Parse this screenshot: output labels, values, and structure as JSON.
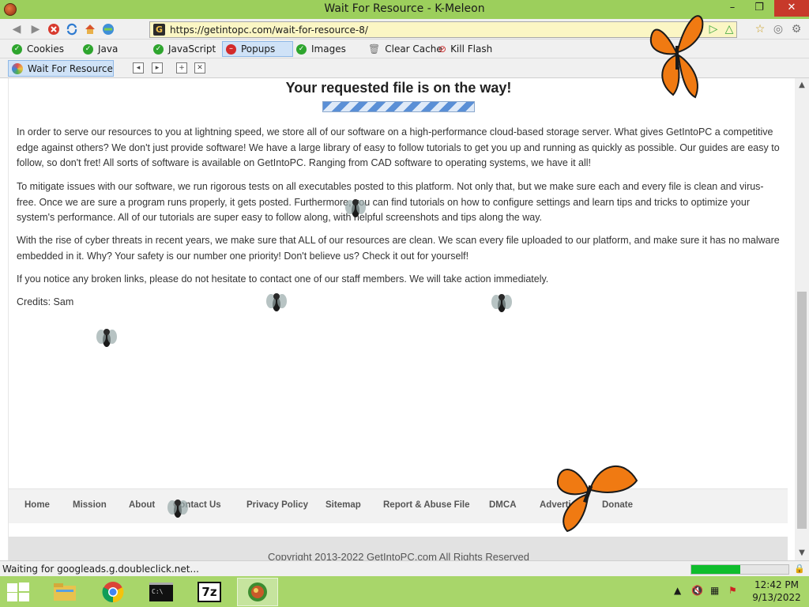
{
  "window": {
    "title": "Wait For Resource - K-Meleon",
    "minimize": "–",
    "maximize": "❐",
    "close": "✕"
  },
  "navbar": {
    "url": "https://getintopc.com/wait-for-resource-8/",
    "favicon_letter": "G"
  },
  "privacy_bar": {
    "cookies": "Cookies",
    "java": "Java",
    "javascript": "JavaScript",
    "popups": "Popups",
    "images": "Images",
    "clear_cache": "Clear Cache",
    "kill_flash": "Kill Flash"
  },
  "tab": {
    "label": "Wait For Resource"
  },
  "content": {
    "headline": "Your requested file is on the way!",
    "paragraphs": [
      "In order to serve our resources to you at lightning speed, we store all of our software on a high-performance cloud-based storage server. What gives GetIntoPC a competitive edge against others? We don't just provide software! We have a large library of easy to follow tutorials to get you up and running as quickly as possible. Our guides are easy to follow, so don't fret! All sorts of software is available on GetIntoPC. Ranging from CAD software to operating systems, we have it all!",
      "To mitigate issues with our software, we run rigorous tests on all executables posted to this platform. Not only that, but we make sure each and every file is clean and virus-free. Once we are sure a program runs properly, it gets posted. Furthermore, you can find tutorials on how to configure settings and learn tips and tricks to optimize your system's performance. All of our tutorials are super easy to follow along, with helpful screenshots and tips along the way.",
      "With the rise of cyber threats in recent years, we make sure that ALL of our resources are clean. We scan every file uploaded to our platform, and make sure it has no malware embedded in it. Why? Your safety is our number one priority! Don't believe us? Check it out for yourself!",
      "If you notice any broken links, please do not hesitate to contact one of our staff members. We will take action immediately.",
      "Credits: Sam"
    ],
    "footer_links": [
      "Home",
      "Mission",
      "About",
      "Contact Us",
      "Privacy Policy",
      "Sitemap",
      "Report & Abuse File",
      "DMCA",
      "Advertise",
      "Donate"
    ],
    "copyright": "Copyright 2013-2022 GetIntoPC.com All Rights Reserved"
  },
  "statusbar": {
    "text": "Waiting for googleads.g.doubleclick.net...",
    "progress": 0.5
  },
  "taskbar": {
    "time": "12:42 PM",
    "date": "9/13/2022",
    "apps": [
      "file-explorer",
      "chrome",
      "terminal",
      "7zip",
      "k-meleon"
    ],
    "sevenzip_label": "7z"
  },
  "colors": {
    "titlebar": "#9ccf5c",
    "taskbar": "#a8d66a",
    "close": "#c7392a",
    "status_fill": "#0fbd2c"
  }
}
